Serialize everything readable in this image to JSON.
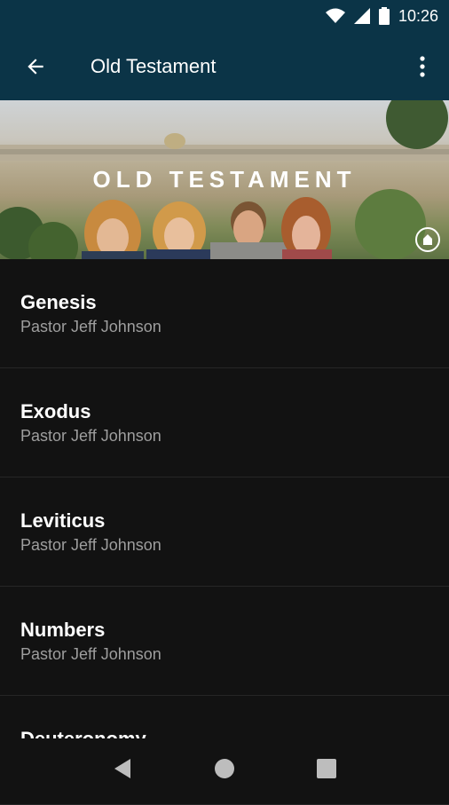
{
  "status": {
    "time": "10:26"
  },
  "appbar": {
    "title": "Old Testament"
  },
  "hero": {
    "title": "OLD TESTAMENT"
  },
  "items": [
    {
      "title": "Genesis",
      "subtitle": "Pastor Jeff Johnson"
    },
    {
      "title": "Exodus",
      "subtitle": "Pastor Jeff Johnson"
    },
    {
      "title": "Leviticus",
      "subtitle": "Pastor Jeff Johnson"
    },
    {
      "title": "Numbers",
      "subtitle": "Pastor Jeff Johnson"
    },
    {
      "title": "Deuteronomy",
      "subtitle": ""
    }
  ],
  "icons": {
    "wifi": "wifi-icon",
    "signal": "signal-icon",
    "battery": "battery-icon",
    "back": "back-arrow-icon",
    "more": "more-vert-icon",
    "nav_back": "nav-back-icon",
    "nav_home": "nav-home-icon",
    "nav_recents": "nav-recents-icon"
  },
  "colors": {
    "appbar": "#0b3447",
    "background": "#121212",
    "subtitle": "#9e9e9e"
  }
}
